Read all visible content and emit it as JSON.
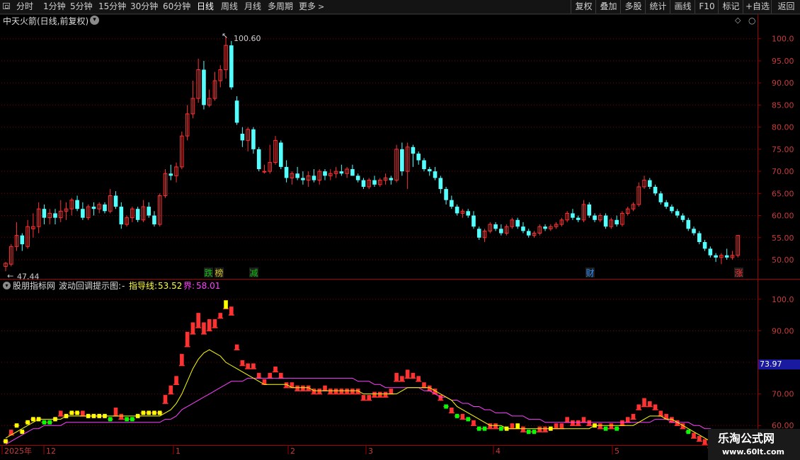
{
  "toolbar": {
    "periods": [
      "分时",
      "1分钟",
      "5分钟",
      "15分钟",
      "30分钟",
      "60分钟",
      "日线",
      "周线",
      "月线",
      "多周期",
      "更多"
    ],
    "active_period": "日线",
    "right_buttons": [
      "复权",
      "叠加",
      "多股",
      "统计",
      "画线",
      "F10",
      "标记",
      "+自选",
      "返回"
    ]
  },
  "main_title": "中天火箭(日线,前复权)",
  "price_high_label": "100.60",
  "price_low_label": "47.44",
  "events": [
    {
      "text": "跌",
      "color": "#10c010"
    },
    {
      "text": "榜",
      "color": "#d0c020"
    },
    {
      "text": "减",
      "color": "#10c010"
    },
    {
      "text": "财",
      "color": "#3090ff"
    },
    {
      "text": "涨",
      "color": "#ff3030"
    }
  ],
  "indicator": {
    "source": "股朋指标网",
    "name": "波动回调提示图:",
    "dash": "-",
    "guide_label": "指导线:",
    "guide_value": "53.52",
    "bound_label": "界:",
    "bound_value": "58.01",
    "current_marker": "73.97"
  },
  "main_axis": [
    "100.0",
    "95.00",
    "90.00",
    "85.00",
    "80.00",
    "75.00",
    "70.00",
    "65.00",
    "60.00",
    "55.00",
    "50.00"
  ],
  "sub_axis": [
    "100.0",
    "90.00",
    "80.00",
    "70.00",
    "60.00"
  ],
  "date_axis": [
    "2025年",
    "12",
    "1",
    "2",
    "3",
    "4",
    "5"
  ],
  "watermark": {
    "title": "乐淘公式网",
    "url": "www.60lt.com"
  },
  "colors": {
    "up": "#ff3232",
    "down": "#54ffff",
    "guide": "#ffff00",
    "bound": "#ff40ff",
    "green_line": "#00ff00",
    "grid": "#7a0000"
  },
  "chart_data": {
    "type": "candlestick",
    "ylim": [
      46,
      103
    ],
    "candles": [
      [
        48.5,
        49.5,
        47.4,
        49.2
      ],
      [
        49.0,
        53.5,
        48.5,
        53.0
      ],
      [
        53.0,
        58.5,
        52.0,
        55.5
      ],
      [
        55.5,
        56.0,
        52.0,
        53.5
      ],
      [
        53.0,
        59.0,
        52.5,
        57.5
      ],
      [
        57.0,
        60.5,
        55.0,
        57.5
      ],
      [
        57.5,
        63.0,
        56.0,
        61.5
      ],
      [
        61.5,
        62.5,
        58.0,
        59.5
      ],
      [
        59.5,
        61.5,
        58.0,
        60.5
      ],
      [
        60.5,
        61.5,
        58.0,
        59.5
      ],
      [
        59.5,
        63.5,
        58.5,
        61.0
      ],
      [
        61.0,
        63.0,
        59.0,
        61.5
      ],
      [
        61.5,
        64.0,
        60.0,
        63.5
      ],
      [
        63.5,
        64.5,
        61.0,
        61.5
      ],
      [
        61.5,
        63.0,
        59.0,
        59.5
      ],
      [
        59.5,
        62.5,
        59.0,
        62.0
      ],
      [
        62.0,
        63.0,
        60.0,
        61.5
      ],
      [
        61.5,
        63.0,
        60.5,
        62.5
      ],
      [
        62.5,
        63.0,
        60.5,
        61.0
      ],
      [
        61.0,
        66.0,
        60.5,
        64.5
      ],
      [
        64.5,
        65.5,
        61.5,
        62.0
      ],
      [
        62.0,
        63.0,
        57.0,
        58.0
      ],
      [
        58.0,
        60.0,
        57.5,
        59.5
      ],
      [
        59.5,
        62.0,
        58.5,
        61.5
      ],
      [
        61.5,
        62.0,
        58.5,
        59.0
      ],
      [
        59.0,
        63.5,
        58.5,
        62.0
      ],
      [
        62.0,
        63.0,
        59.5,
        60.0
      ],
      [
        60.0,
        61.0,
        57.5,
        58.0
      ],
      [
        58.0,
        65.0,
        57.5,
        64.5
      ],
      [
        64.5,
        70.5,
        64.0,
        69.5
      ],
      [
        69.5,
        71.5,
        68.0,
        69.0
      ],
      [
        69.0,
        72.0,
        67.5,
        71.0
      ],
      [
        71.0,
        79.0,
        70.5,
        78.0
      ],
      [
        78.0,
        85.0,
        77.0,
        83.0
      ],
      [
        83.0,
        90.5,
        82.0,
        86.5
      ],
      [
        86.5,
        95.5,
        85.5,
        93.0
      ],
      [
        93.0,
        95.0,
        84.0,
        85.0
      ],
      [
        85.0,
        88.5,
        84.5,
        86.5
      ],
      [
        86.5,
        92.5,
        86.0,
        90.5
      ],
      [
        90.5,
        94.0,
        89.0,
        93.0
      ],
      [
        93.0,
        100.6,
        91.0,
        98.5
      ],
      [
        98.5,
        99.5,
        88.5,
        89.0
      ],
      [
        86.0,
        87.0,
        80.5,
        81.0
      ],
      [
        78.5,
        80.0,
        75.5,
        77.0
      ],
      [
        77.0,
        80.0,
        74.5,
        79.5
      ],
      [
        79.5,
        80.0,
        74.0,
        75.0
      ],
      [
        75.0,
        75.5,
        70.0,
        70.5
      ],
      [
        70.0,
        71.5,
        69.5,
        70.0
      ],
      [
        70.0,
        76.0,
        69.5,
        72.0
      ],
      [
        72.0,
        78.0,
        71.5,
        77.0
      ],
      [
        76.5,
        77.0,
        70.5,
        71.0
      ],
      [
        71.0,
        72.5,
        67.5,
        68.5
      ],
      [
        68.5,
        70.0,
        67.0,
        69.5
      ],
      [
        69.5,
        71.0,
        68.0,
        68.5
      ],
      [
        68.5,
        70.0,
        67.0,
        68.0
      ],
      [
        68.0,
        70.0,
        66.5,
        69.0
      ],
      [
        69.0,
        70.5,
        67.5,
        68.0
      ],
      [
        68.0,
        70.5,
        67.0,
        70.0
      ],
      [
        70.0,
        70.5,
        68.0,
        69.0
      ],
      [
        69.0,
        70.5,
        68.0,
        69.5
      ],
      [
        69.5,
        71.0,
        68.5,
        70.0
      ],
      [
        70.0,
        71.5,
        69.0,
        69.5
      ],
      [
        69.5,
        71.0,
        68.5,
        70.5
      ],
      [
        70.5,
        71.5,
        69.0,
        69.0
      ],
      [
        69.0,
        69.5,
        67.5,
        68.0
      ],
      [
        68.0,
        68.5,
        66.0,
        66.5
      ],
      [
        66.5,
        68.5,
        66.0,
        68.0
      ],
      [
        68.0,
        69.0,
        66.5,
        67.0
      ],
      [
        67.0,
        68.5,
        66.5,
        68.0
      ],
      [
        68.0,
        69.5,
        67.0,
        68.5
      ],
      [
        68.5,
        69.0,
        67.0,
        68.0
      ],
      [
        68.0,
        76.0,
        67.5,
        75.0
      ],
      [
        75.0,
        76.5,
        69.0,
        70.0
      ],
      [
        70.0,
        76.5,
        66.0,
        75.5
      ],
      [
        75.5,
        76.0,
        71.0,
        74.0
      ],
      [
        74.0,
        74.5,
        71.5,
        72.5
      ],
      [
        72.5,
        73.0,
        70.0,
        70.5
      ],
      [
        70.5,
        71.0,
        69.0,
        70.0
      ],
      [
        70.0,
        71.0,
        68.0,
        68.5
      ],
      [
        68.5,
        69.0,
        65.0,
        66.0
      ],
      [
        66.0,
        66.5,
        62.5,
        63.5
      ],
      [
        63.5,
        64.5,
        61.5,
        62.0
      ],
      [
        62.0,
        62.5,
        60.0,
        60.5
      ],
      [
        60.5,
        61.5,
        59.5,
        61.0
      ],
      [
        61.0,
        61.5,
        59.5,
        60.0
      ],
      [
        60.0,
        61.0,
        57.0,
        57.5
      ],
      [
        57.0,
        57.5,
        54.5,
        55.0
      ],
      [
        55.0,
        57.0,
        54.0,
        56.5
      ],
      [
        56.5,
        58.5,
        56.0,
        58.0
      ],
      [
        58.0,
        58.5,
        56.5,
        57.0
      ],
      [
        57.0,
        58.0,
        55.5,
        56.0
      ],
      [
        56.0,
        58.0,
        55.5,
        57.5
      ],
      [
        57.5,
        59.5,
        57.0,
        59.0
      ],
      [
        59.0,
        59.5,
        57.0,
        57.5
      ],
      [
        57.5,
        58.5,
        56.0,
        56.5
      ],
      [
        56.5,
        57.0,
        55.0,
        55.5
      ],
      [
        55.5,
        56.5,
        55.0,
        56.0
      ],
      [
        56.0,
        58.0,
        55.5,
        57.5
      ],
      [
        57.5,
        58.0,
        56.5,
        57.0
      ],
      [
        57.0,
        58.0,
        56.5,
        57.5
      ],
      [
        57.5,
        58.5,
        57.0,
        58.0
      ],
      [
        58.0,
        59.5,
        57.5,
        59.0
      ],
      [
        59.0,
        61.0,
        58.5,
        60.5
      ],
      [
        60.5,
        61.5,
        59.0,
        59.5
      ],
      [
        59.5,
        60.0,
        58.5,
        59.0
      ],
      [
        59.0,
        63.5,
        58.5,
        62.5
      ],
      [
        62.5,
        63.0,
        59.5,
        60.0
      ],
      [
        60.0,
        60.5,
        58.5,
        59.0
      ],
      [
        59.0,
        60.5,
        58.5,
        60.0
      ],
      [
        60.0,
        60.5,
        57.0,
        57.5
      ],
      [
        57.5,
        59.5,
        57.0,
        59.0
      ],
      [
        59.0,
        60.0,
        57.5,
        58.0
      ],
      [
        58.0,
        61.0,
        57.5,
        60.5
      ],
      [
        60.5,
        62.0,
        60.0,
        61.5
      ],
      [
        61.5,
        63.0,
        61.0,
        62.5
      ],
      [
        62.5,
        67.5,
        62.0,
        66.5
      ],
      [
        66.5,
        69.0,
        66.0,
        68.0
      ],
      [
        68.0,
        68.5,
        66.0,
        66.5
      ],
      [
        66.5,
        67.0,
        64.5,
        65.0
      ],
      [
        65.0,
        65.5,
        62.5,
        63.0
      ],
      [
        63.0,
        63.5,
        61.5,
        62.0
      ],
      [
        62.0,
        62.5,
        60.5,
        61.0
      ],
      [
        61.0,
        61.5,
        59.5,
        60.0
      ],
      [
        60.0,
        60.5,
        58.5,
        59.0
      ],
      [
        59.0,
        59.5,
        56.5,
        57.0
      ],
      [
        57.0,
        57.5,
        55.5,
        56.0
      ],
      [
        56.0,
        56.5,
        53.5,
        54.0
      ],
      [
        54.0,
        54.5,
        52.0,
        52.5
      ],
      [
        52.5,
        53.0,
        50.5,
        51.0
      ],
      [
        51.0,
        51.5,
        49.5,
        50.5
      ],
      [
        50.5,
        51.5,
        49.0,
        51.0
      ],
      [
        51.0,
        52.5,
        50.0,
        50.5
      ],
      [
        50.5,
        52.0,
        50.0,
        51.0
      ],
      [
        51.0,
        55.5,
        50.5,
        55.5
      ]
    ],
    "osc_ylim": [
      54,
      104
    ],
    "osc_cur": [
      55,
      58,
      60,
      58,
      61,
      62,
      62,
      61,
      61,
      62,
      64,
      63,
      64,
      64,
      64,
      63,
      63,
      63,
      63,
      62,
      65,
      63,
      62,
      62,
      63,
      64,
      64,
      64,
      64,
      69,
      72,
      75,
      82,
      89,
      92,
      95,
      92,
      93,
      93,
      95,
      99,
      97,
      85,
      80,
      79,
      79,
      76,
      74,
      76,
      78,
      76,
      73,
      73,
      72,
      72,
      72,
      71,
      71,
      72,
      71,
      71,
      71,
      71,
      71,
      71,
      69,
      69,
      70,
      70,
      70,
      71,
      76,
      75,
      77,
      76,
      75,
      73,
      72,
      71,
      69,
      66,
      65,
      63,
      63,
      62,
      61,
      59,
      59,
      60,
      60,
      59,
      59,
      60,
      60,
      59,
      58,
      58,
      59,
      59,
      59,
      60,
      60,
      62,
      61,
      61,
      62,
      61,
      60,
      60,
      59,
      60,
      59,
      61,
      62,
      63,
      66,
      68,
      67,
      66,
      64,
      63,
      62,
      61,
      60,
      58,
      57,
      56,
      55,
      53,
      53
    ],
    "osc_prev": [
      55,
      57,
      60,
      58,
      61,
      62,
      62,
      61,
      61,
      62,
      63,
      63,
      64,
      64,
      63,
      63,
      63,
      63,
      63,
      62,
      63,
      62,
      62,
      62,
      63,
      64,
      64,
      64,
      64,
      67,
      70,
      73,
      79,
      85,
      89,
      91,
      89,
      90,
      91,
      94,
      97,
      95,
      84,
      79,
      78,
      78,
      75,
      73,
      75,
      77,
      75,
      72,
      72,
      71,
      71,
      71,
      70,
      70,
      71,
      70,
      70,
      70,
      70,
      70,
      70,
      68,
      68,
      69,
      69,
      69,
      70,
      74,
      74,
      75,
      75,
      74,
      72,
      71,
      70,
      68,
      66,
      64,
      63,
      62,
      62,
      60,
      59,
      59,
      59,
      59,
      59,
      59,
      59,
      59,
      58,
      58,
      58,
      58,
      58,
      59,
      59,
      59,
      61,
      60,
      60,
      61,
      60,
      60,
      59,
      59,
      59,
      59,
      60,
      61,
      62,
      65,
      66,
      66,
      65,
      63,
      62,
      61,
      60,
      59,
      58,
      56,
      55,
      54,
      53,
      52
    ],
    "guide": [
      56,
      57,
      58,
      59,
      60,
      61,
      62,
      62,
      62,
      62,
      62,
      63,
      63,
      63,
      63,
      63,
      63,
      63,
      63,
      63,
      63,
      63,
      63,
      63,
      63,
      63,
      63,
      63,
      63,
      64,
      65,
      67,
      70,
      74,
      78,
      81,
      83,
      84,
      83,
      82,
      80,
      79,
      78,
      77,
      76,
      75,
      74,
      73,
      73,
      73,
      73,
      73,
      72,
      72,
      72,
      72,
      71,
      71,
      71,
      71,
      71,
      71,
      71,
      71,
      71,
      70,
      70,
      70,
      70,
      70,
      70,
      70,
      71,
      72,
      72,
      72,
      72,
      72,
      71,
      70,
      69,
      68,
      66,
      65,
      64,
      63,
      62,
      61,
      60,
      60,
      60,
      59,
      59,
      59,
      59,
      59,
      59,
      59,
      59,
      59,
      59,
      59,
      59,
      59,
      59,
      59,
      59,
      60,
      60,
      60,
      60,
      60,
      60,
      60,
      60,
      61,
      62,
      63,
      63,
      63,
      62,
      62,
      61,
      60,
      59,
      58,
      57,
      56,
      55,
      54
    ],
    "bound": [
      54,
      55,
      56,
      57,
      58,
      59,
      59,
      60,
      60,
      60,
      60,
      61,
      61,
      61,
      61,
      61,
      61,
      61,
      61,
      61,
      61,
      61,
      61,
      61,
      61,
      61,
      61,
      61,
      61,
      62,
      62,
      63,
      65,
      66,
      67,
      68,
      69,
      70,
      71,
      72,
      73,
      74,
      74,
      74,
      75,
      75,
      75,
      75,
      75,
      75,
      75,
      75,
      75,
      75,
      75,
      75,
      75,
      75,
      75,
      75,
      75,
      75,
      75,
      75,
      74,
      74,
      74,
      73,
      73,
      72,
      72,
      72,
      72,
      72,
      72,
      72,
      71,
      71,
      70,
      69,
      69,
      68,
      68,
      67,
      67,
      66,
      66,
      65,
      65,
      64,
      64,
      64,
      63,
      63,
      63,
      62,
      62,
      62,
      61,
      61,
      61,
      61,
      61,
      61,
      61,
      61,
      61,
      61,
      61,
      61,
      61,
      61,
      61,
      61,
      61,
      61,
      61,
      61,
      62,
      62,
      62,
      61,
      61,
      61,
      61,
      60,
      60,
      59,
      59,
      58
    ]
  }
}
